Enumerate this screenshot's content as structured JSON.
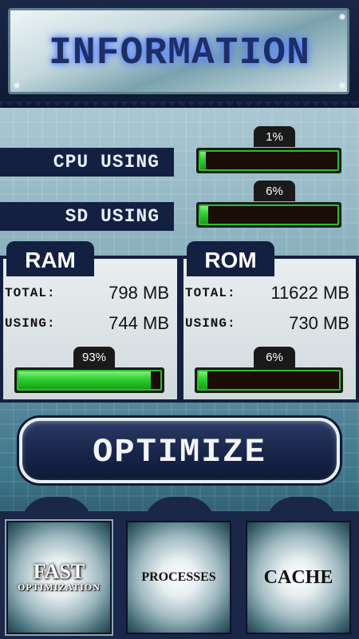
{
  "header": {
    "title": "INFORMATION"
  },
  "stats": [
    {
      "label": "CPU USING",
      "percent_label": "1%",
      "fraction": 0.01
    },
    {
      "label": "SD USING",
      "percent_label": "6%",
      "fraction": 0.06
    }
  ],
  "ram": {
    "title": "RAM",
    "total_label": "TOTAL:",
    "total_value": "798 MB",
    "using_label": "USING:",
    "using_value": "744 MB",
    "percent_label": "93%",
    "fraction": 0.93
  },
  "rom": {
    "title": "ROM",
    "total_label": "TOTAL:",
    "total_value": "11622 MB",
    "using_label": "USING:",
    "using_value": "730 MB",
    "percent_label": "6%",
    "fraction": 0.06
  },
  "optimize_label": "OPTIMIZE",
  "tabs": {
    "fast_main": "FAST",
    "fast_sub": "OPTIMIZATION",
    "processes": "PROCESSES",
    "cache": "CACHE"
  },
  "colors": {
    "navy": "#142042",
    "bar_green": "#2fcc2f"
  }
}
